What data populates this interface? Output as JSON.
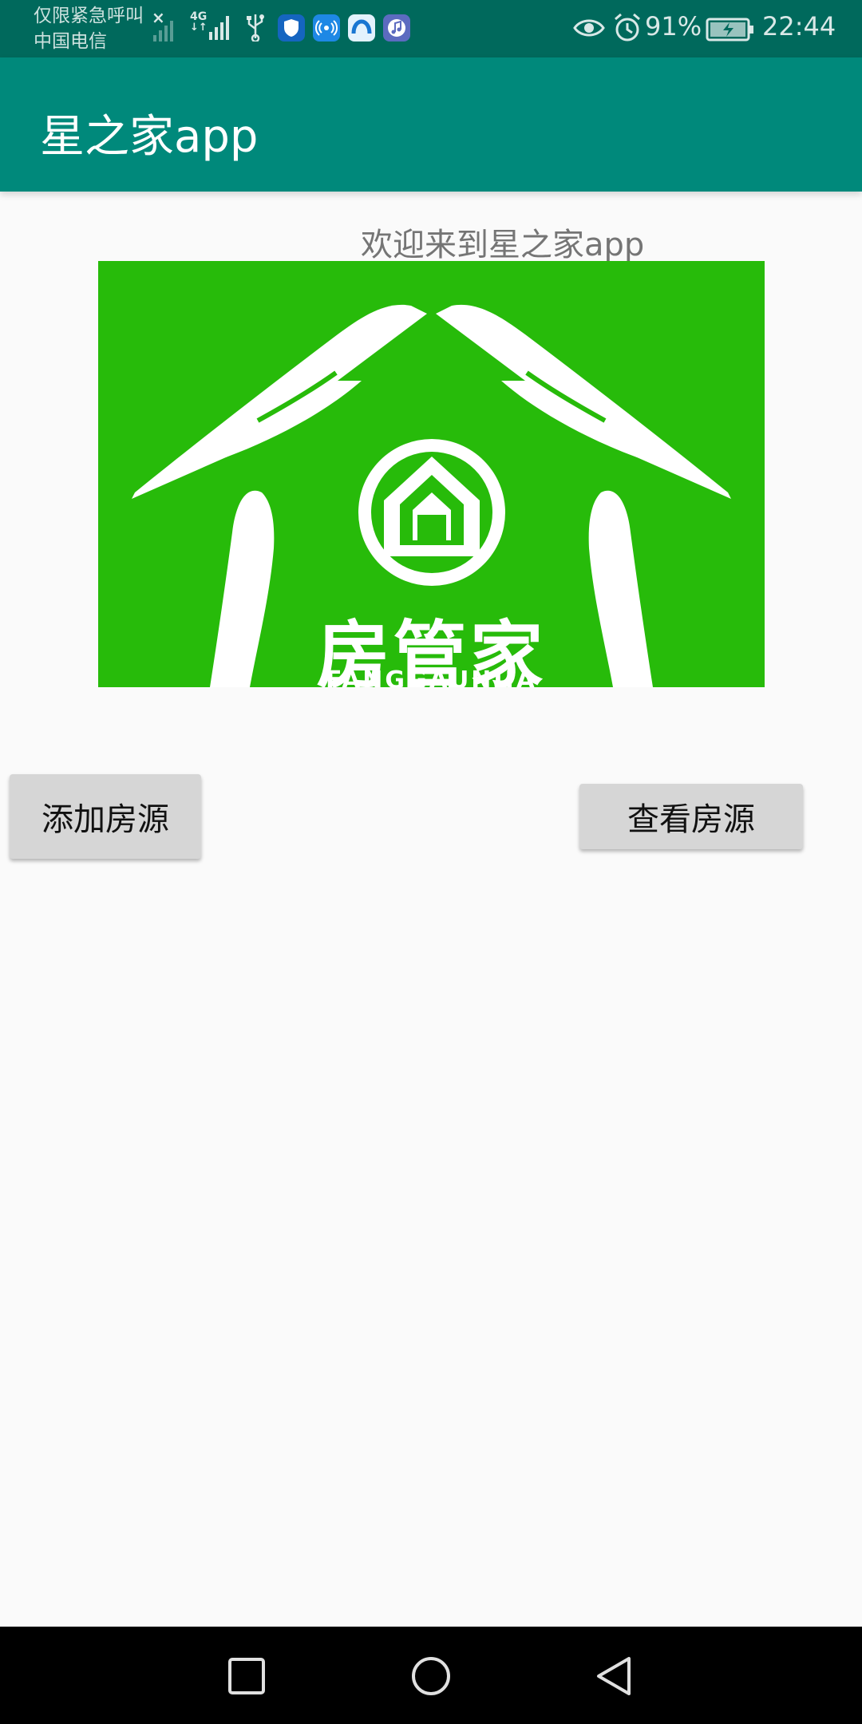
{
  "status_bar": {
    "carrier_line1": "仅限紧急呼叫",
    "carrier_line2": "中国电信",
    "signal_x": "×",
    "network_type_top": "4G",
    "network_type_bottom": "↓↑",
    "battery_percent": "91%",
    "time": "22:44",
    "icons": [
      "no-signal-icon",
      "signal-icon",
      "usb-icon",
      "shield-app-icon",
      "wifi-hotspot-app-icon",
      "cloud-app-icon",
      "music-app-icon",
      "eye-icon",
      "alarm-icon",
      "battery-charging-icon"
    ]
  },
  "toolbar": {
    "title": "星之家app"
  },
  "main": {
    "welcome": "欢迎来到星之家app",
    "logo": {
      "title": "房管家",
      "subtitle": "FANGGAUNJIA"
    },
    "add_button_label": "添加房源",
    "view_button_label": "查看房源"
  },
  "nav_bar": {
    "icons": [
      "recents-icon",
      "home-icon",
      "back-icon"
    ]
  },
  "colors": {
    "status_bar": "#00695c",
    "toolbar": "#00897b",
    "logo_green": "#27bb0a",
    "button_bg": "#d6d6d6",
    "page_bg": "#fafafa"
  }
}
